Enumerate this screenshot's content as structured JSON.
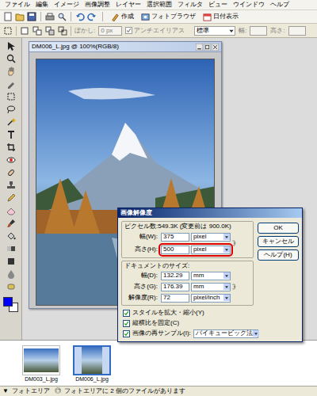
{
  "menu": [
    "ファイル",
    "編集",
    "イメージ",
    "画像調整",
    "レイヤー",
    "選択範囲",
    "フィルタ",
    "ビュー",
    "ウインドウ",
    "ヘルプ"
  ],
  "toolbar": {
    "buttons": [
      {
        "label": "作成"
      },
      {
        "label": "フォトブラウザ"
      },
      {
        "label": "日付表示"
      }
    ]
  },
  "options_bar": {
    "feather_label": "ぼかし:",
    "feather_value": "0 px",
    "antialias": {
      "label": "アンチエイリアス",
      "checked": true,
      "disabled": true
    },
    "style": "標準",
    "width_label": "幅:",
    "height_label": "高さ:"
  },
  "colors": {
    "foreground": "#0000ff",
    "background": "#ffffff"
  },
  "document": {
    "title": "DM006_L.jpg @ 100%(RGB/8)"
  },
  "dialog": {
    "title": "画像解像度",
    "pixel_group": {
      "label": "ピクセル数:549.3K (変更前は 900.0K)",
      "fields": [
        {
          "label": "幅(W):",
          "value": "375",
          "unit": "pixel",
          "highlighted": false
        },
        {
          "label": "高さ(H):",
          "value": "500",
          "unit": "pixel",
          "highlighted": true
        }
      ]
    },
    "document_group": {
      "label": "ドキュメントのサイズ:",
      "fields": [
        {
          "label": "幅(D):",
          "value": "132.29",
          "unit": "mm",
          "highlighted": false
        },
        {
          "label": "高さ(G):",
          "value": "176.39",
          "unit": "mm",
          "highlighted": false
        },
        {
          "label": "解像度(R):",
          "value": "72",
          "unit": "pixel/inch",
          "highlighted": false
        }
      ]
    },
    "buttons": [
      "OK",
      "キャンセル",
      "ヘルプ(H)"
    ],
    "options": [
      {
        "label": "スタイルを拡大・縮小(Y)",
        "checked": true
      },
      {
        "label": "縦横比を固定(C)",
        "checked": true
      },
      {
        "label": "画像の再サンプル(I):",
        "checked": true,
        "method": "バイキュービック法"
      }
    ]
  },
  "photo_bin": {
    "items": [
      {
        "label": "DM003_L.jpg",
        "selected": false
      },
      {
        "label": "DM006_L.jpg",
        "selected": true
      }
    ]
  },
  "status_bar": {
    "toggle": "▼",
    "label": "フォトエリア",
    "icon": "◎",
    "message": "フォトエリアに 2 個のファイルがあります"
  }
}
